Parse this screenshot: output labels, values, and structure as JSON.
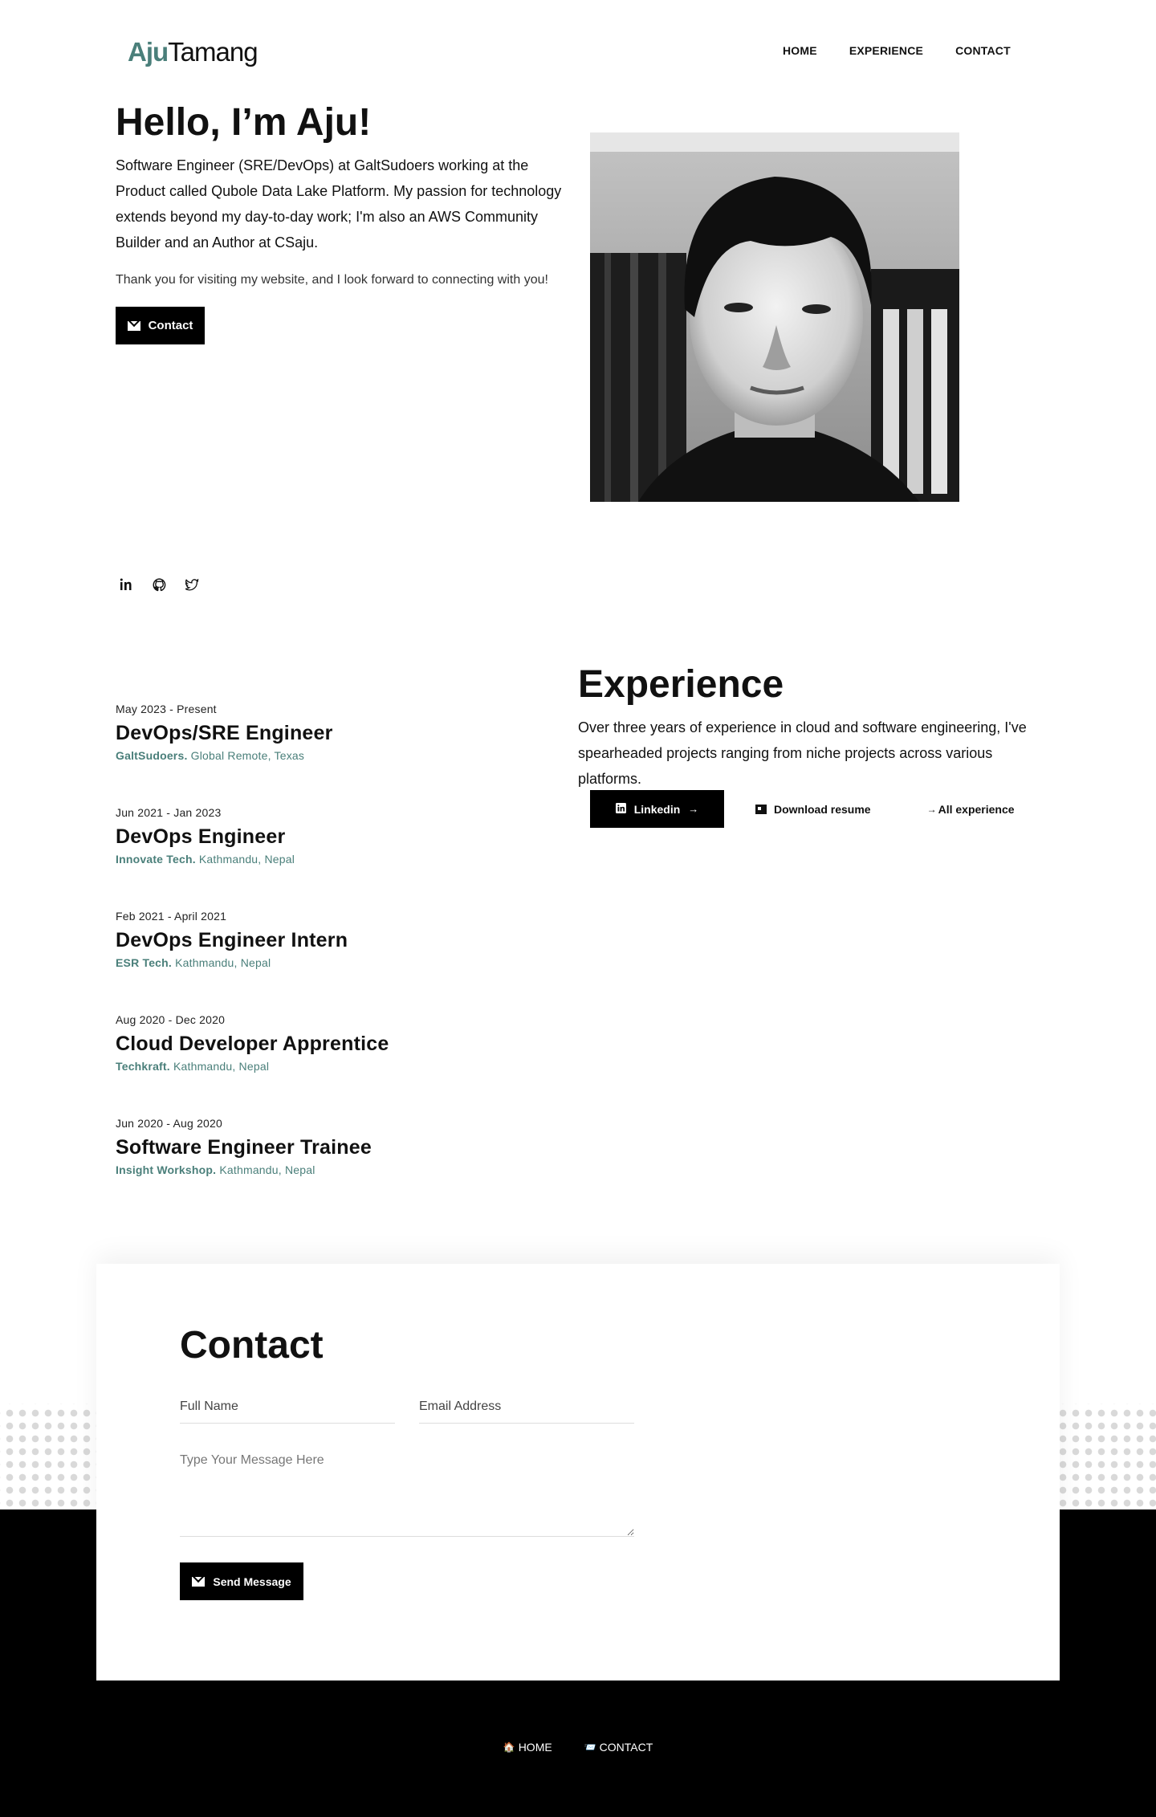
{
  "header": {
    "logo_first": "Aju",
    "logo_last": "Tamang",
    "nav": [
      "HOME",
      "EXPERIENCE",
      "CONTACT"
    ]
  },
  "hero": {
    "title": "Hello, I’m Aju!",
    "bio": "Software Engineer (SRE/DevOps) at GaltSudoers working at the Product called Qubole Data Lake Platform. My passion for technology extends beyond my day-to-day work; I'm also an AWS Community Builder and an Author at CSaju.",
    "thanks": "Thank you for visiting my website, and I look forward to connecting with you!",
    "contact_button": "Contact"
  },
  "social": {
    "icons": [
      "linkedin-icon",
      "github-icon",
      "twitter-icon"
    ]
  },
  "experience": {
    "title": "Experience",
    "description": "Over three years of experience in cloud and software engineering, I've spearheaded projects ranging from niche projects across various platforms.",
    "linkedin_button": "Linkedin",
    "resume_button": "Download resume",
    "all_button": "All experience",
    "jobs": [
      {
        "dates": "May 2023 - Present",
        "role": "DevOps/SRE Engineer",
        "company": "GaltSudoers.",
        "location": "Global Remote, Texas"
      },
      {
        "dates": "Jun 2021 - Jan 2023",
        "role": "DevOps Engineer",
        "company": "Innovate Tech.",
        "location": "Kathmandu, Nepal"
      },
      {
        "dates": "Feb 2021 - April 2021",
        "role": "DevOps Engineer Intern",
        "company": "ESR Tech.",
        "location": "Kathmandu, Nepal"
      },
      {
        "dates": "Aug 2020 - Dec 2020",
        "role": "Cloud Developer Apprentice",
        "company": "Techkraft.",
        "location": "Kathmandu, Nepal"
      },
      {
        "dates": "Jun 2020 - Aug 2020",
        "role": "Software Engineer Trainee",
        "company": "Insight Workshop.",
        "location": "Kathmandu, Nepal"
      }
    ]
  },
  "contact": {
    "title": "Contact",
    "name_placeholder": "Full Name",
    "email_placeholder": "Email Address",
    "message_placeholder": "Type Your Message Here",
    "send_button": "Send Message"
  },
  "footer": {
    "home": "HOME",
    "contact": "CONTACT"
  },
  "colors": {
    "accent": "#4a7f7a",
    "black": "#000000"
  }
}
